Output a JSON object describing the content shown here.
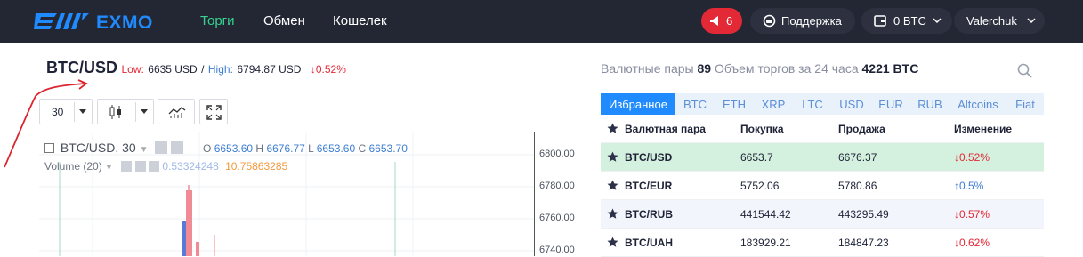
{
  "header": {
    "brand": "EXMO",
    "nav": [
      "Торги",
      "Обмен",
      "Кошелек"
    ],
    "notifications_count": "6",
    "support_label": "Поддержка",
    "wallet_label": "0 BTC",
    "username": "Valerchuk"
  },
  "pair": {
    "title": "BTC/USD",
    "low_label": "Low:",
    "low_value": "6635 USD",
    "separator": "/",
    "high_label": "High:",
    "high_value": "6794.87 USD",
    "change": "↓0.52%"
  },
  "chart": {
    "interval": "30",
    "legend": "BTC/USD, 30",
    "ohlc": {
      "o_label": "O",
      "o_value": "6653.60",
      "h_label": "H",
      "h_value": "6676.77",
      "l_label": "L",
      "l_value": "6653.60",
      "c_label": "C",
      "c_value": "6653.70"
    },
    "volume_label": "Volume (20)",
    "volume_v1": "0.53324248",
    "volume_v2": "10.75863285",
    "y_ticks": [
      "6800.00",
      "6780.00",
      "6760.00",
      "6740.00"
    ]
  },
  "markets": {
    "pairs_label": "Валютные пары",
    "pairs_count": "89",
    "volume_label": "Объем торгов за 24 часа",
    "volume_value": "4221 BTC",
    "tabs": [
      "Избранное",
      "BTC",
      "ETH",
      "XRP",
      "LTC",
      "USD",
      "EUR",
      "RUB",
      "Altcoins",
      "Fiat"
    ],
    "columns": [
      "Валютная пара",
      "Покупка",
      "Продажа",
      "Изменение"
    ],
    "rows": [
      {
        "pair": "BTC/USD",
        "buy": "6653.7",
        "sell": "6676.37",
        "change": "↓0.52%",
        "dir": "down"
      },
      {
        "pair": "BTC/EUR",
        "buy": "5752.06",
        "sell": "5780.86",
        "change": "↑0.5%",
        "dir": "up"
      },
      {
        "pair": "BTC/RUB",
        "buy": "441544.42",
        "sell": "443295.49",
        "change": "↓0.57%",
        "dir": "down"
      },
      {
        "pair": "BTC/UAH",
        "buy": "183929.21",
        "sell": "184847.23",
        "change": "↓0.62%",
        "dir": "down"
      }
    ]
  },
  "colors": {
    "topbar": "#232734",
    "accent": "#1f8bff",
    "active_nav": "#36d28e",
    "down": "#e32836",
    "up": "#3e7ed3"
  }
}
